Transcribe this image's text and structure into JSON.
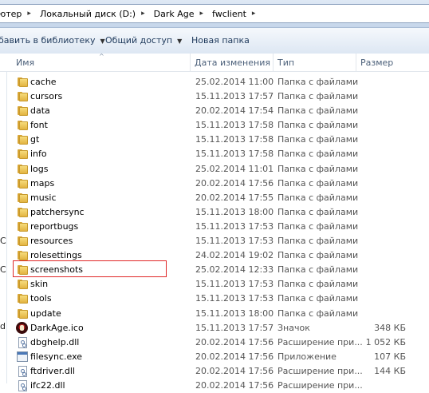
{
  "address": {
    "crumbs": [
      "ютер",
      "Локальный диск (D:)",
      "Dark Age",
      "fwclient"
    ],
    "separator": "▸"
  },
  "toolbar": {
    "library_label": "бавить в библиотеку",
    "share_label": "Общий доступ",
    "new_folder_label": "Новая папка",
    "dropdown_caret": "▼"
  },
  "columns": {
    "name": "Имя",
    "date": "Дата изменения",
    "type": "Тип",
    "size": "Размер",
    "sort_indicator": "^"
  },
  "nav_fragments": [
    "С",
    "С",
    "d"
  ],
  "rows": [
    {
      "name": "cache",
      "date": "25.02.2014 11:00",
      "type": "Папка с файлами",
      "size": "",
      "icon": "folder-icon"
    },
    {
      "name": "cursors",
      "date": "15.11.2013 17:57",
      "type": "Папка с файлами",
      "size": "",
      "icon": "folder-icon"
    },
    {
      "name": "data",
      "date": "20.02.2014 17:54",
      "type": "Папка с файлами",
      "size": "",
      "icon": "folder-icon"
    },
    {
      "name": "font",
      "date": "15.11.2013 17:58",
      "type": "Папка с файлами",
      "size": "",
      "icon": "folder-icon"
    },
    {
      "name": "gt",
      "date": "15.11.2013 17:58",
      "type": "Папка с файлами",
      "size": "",
      "icon": "folder-icon"
    },
    {
      "name": "info",
      "date": "15.11.2013 17:58",
      "type": "Папка с файлами",
      "size": "",
      "icon": "folder-icon"
    },
    {
      "name": "logs",
      "date": "25.02.2014 11:01",
      "type": "Папка с файлами",
      "size": "",
      "icon": "folder-icon"
    },
    {
      "name": "maps",
      "date": "20.02.2014 17:56",
      "type": "Папка с файлами",
      "size": "",
      "icon": "folder-icon"
    },
    {
      "name": "music",
      "date": "20.02.2014 17:55",
      "type": "Папка с файлами",
      "size": "",
      "icon": "folder-icon"
    },
    {
      "name": "patchersync",
      "date": "15.11.2013 18:00",
      "type": "Папка с файлами",
      "size": "",
      "icon": "folder-icon"
    },
    {
      "name": "reportbugs",
      "date": "15.11.2013 17:53",
      "type": "Папка с файлами",
      "size": "",
      "icon": "folder-icon"
    },
    {
      "name": "resources",
      "date": "15.11.2013 17:53",
      "type": "Папка с файлами",
      "size": "",
      "icon": "folder-icon"
    },
    {
      "name": "rolesettings",
      "date": "24.02.2014 19:02",
      "type": "Папка с файлами",
      "size": "",
      "icon": "folder-icon"
    },
    {
      "name": "screenshots",
      "date": "25.02.2014 12:33",
      "type": "Папка с файлами",
      "size": "",
      "icon": "folder-icon"
    },
    {
      "name": "skin",
      "date": "15.11.2013 17:53",
      "type": "Папка с файлами",
      "size": "",
      "icon": "folder-icon"
    },
    {
      "name": "tools",
      "date": "15.11.2013 17:53",
      "type": "Папка с файлами",
      "size": "",
      "icon": "folder-icon"
    },
    {
      "name": "update",
      "date": "15.11.2013 18:00",
      "type": "Папка с файлами",
      "size": "",
      "icon": "folder-icon"
    },
    {
      "name": "DarkAge.ico",
      "date": "15.11.2013 17:57",
      "type": "Значок",
      "size": "348 КБ",
      "icon": "app-icon"
    },
    {
      "name": "dbghelp.dll",
      "date": "20.02.2014 17:56",
      "type": "Расширение при...",
      "size": "1 052 КБ",
      "icon": "dll-icon"
    },
    {
      "name": "filesync.exe",
      "date": "20.02.2014 17:56",
      "type": "Приложение",
      "size": "107 КБ",
      "icon": "exe-icon"
    },
    {
      "name": "ftdriver.dll",
      "date": "20.02.2014 17:56",
      "type": "Расширение при...",
      "size": "144 КБ",
      "icon": "dll-icon"
    },
    {
      "name": "ifc22.dll",
      "date": "20.02.2014 17:56",
      "type": "Расширение при...",
      "size": "",
      "icon": "dll-icon"
    }
  ],
  "highlight": {
    "row": "screenshots",
    "color": "#e02828"
  }
}
